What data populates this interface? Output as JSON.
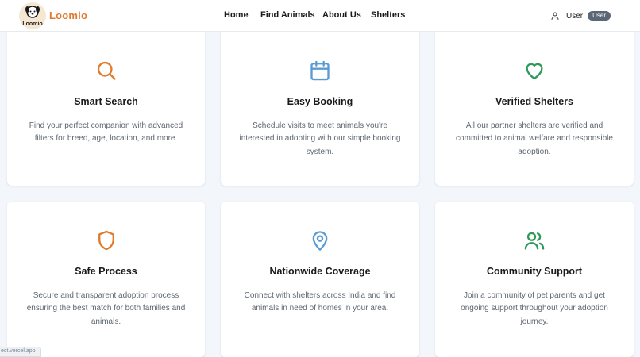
{
  "header": {
    "logo_text": "Loomio",
    "brand": "Loomio",
    "nav": [
      "Home",
      "Find Animals",
      "About Us",
      "Shelters"
    ],
    "user_name": "User",
    "user_badge": "User"
  },
  "cards": [
    {
      "icon": "search-icon",
      "color": "#e07a2e",
      "title": "Smart Search",
      "description": "Find your perfect companion with advanced filters for breed, age, location, and more."
    },
    {
      "icon": "calendar-icon",
      "color": "#5b9bd5",
      "title": "Easy Booking",
      "description": "Schedule visits to meet animals you're interested in adopting with our simple booking system."
    },
    {
      "icon": "heart-icon",
      "color": "#2e9a5a",
      "title": "Verified Shelters",
      "description": "All our partner shelters are verified and committed to animal welfare and responsible adoption."
    },
    {
      "icon": "shield-icon",
      "color": "#e07a2e",
      "title": "Safe Process",
      "description": "Secure and transparent adoption process ensuring the best match for both families and animals."
    },
    {
      "icon": "map-pin-icon",
      "color": "#5b9bd5",
      "title": "Nationwide Coverage",
      "description": "Connect with shelters across India and find animals in need of homes in your area."
    },
    {
      "icon": "users-icon",
      "color": "#2e9a5a",
      "title": "Community Support",
      "description": "Join a community of pet parents and get ongoing support throughout your adoption journey."
    }
  ],
  "status_url": "ect.vercel.app"
}
